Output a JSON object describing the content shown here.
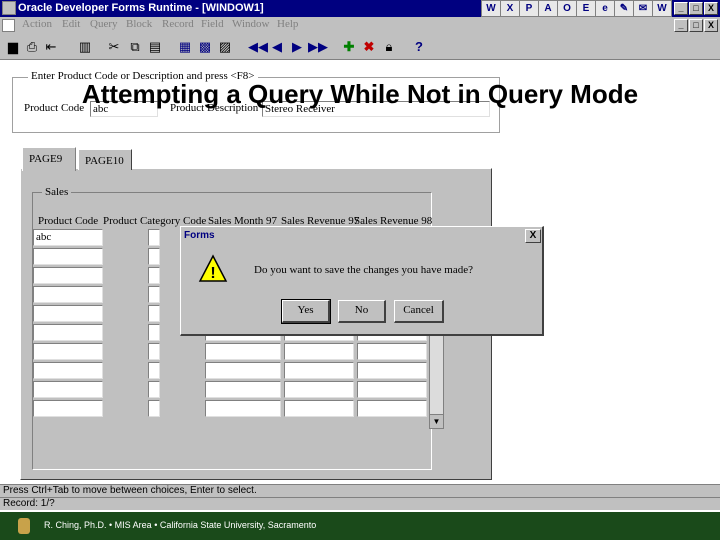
{
  "window": {
    "title": "Oracle Developer Forms Runtime - [WINDOW1]",
    "window_buttons": [
      "_",
      "□",
      "X"
    ]
  },
  "taskbar_icons": [
    "word-icon",
    "excel-icon",
    "powerpoint-icon",
    "access-icon",
    "outlook-icon",
    "explorer-icon",
    "ie-icon",
    "paint-icon",
    "mail-icon",
    "word-doc-icon"
  ],
  "menu": {
    "items": [
      "Action",
      "Edit",
      "Query",
      "Block",
      "Record",
      "Field",
      "Window",
      "Help"
    ]
  },
  "toolbar": {
    "help_glyph": "?"
  },
  "slide": {
    "title": "Attempting a Query While Not in Query Mode"
  },
  "header_frame": {
    "label": "Enter Product Code or Description and press <F8>",
    "product_code_label": "Product Code",
    "product_code_value": "abc",
    "product_description_label": "Product Description",
    "product_description_value": "Stereo Receiver"
  },
  "tabs": [
    {
      "label": "PAGE9"
    },
    {
      "label": "PAGE10"
    }
  ],
  "sales": {
    "frame_label": "Sales",
    "columns": [
      "Product Code",
      "Product Category Code",
      "Sales Month 97",
      "Sales Revenue 97",
      "Sales Revenue 98"
    ],
    "first_value": "abc"
  },
  "dialog": {
    "title": "Forms",
    "message": "Do you want to save the changes you have made?",
    "yes": "Yes",
    "no": "No",
    "cancel": "Cancel",
    "close": "X",
    "warning_glyph": "!"
  },
  "status": {
    "hint": "Press Ctrl+Tab to move between choices, Enter to select.",
    "record": "Record: 1/?"
  },
  "footer": {
    "credit": "R. Ching, Ph.D. • MIS Area • California State University, Sacramento"
  }
}
